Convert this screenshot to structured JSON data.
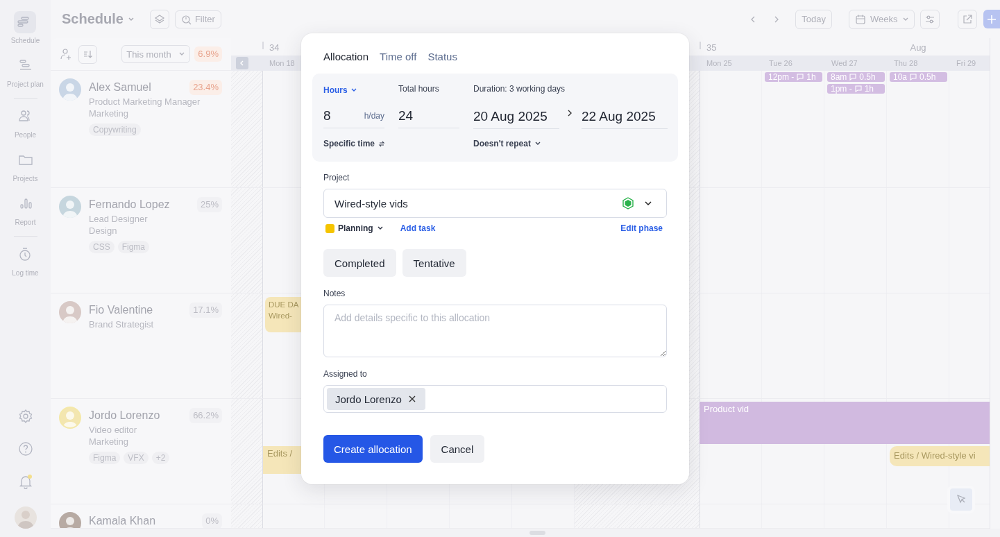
{
  "nav": {
    "items": [
      {
        "label": "Schedule",
        "selected": true
      },
      {
        "label": "Project plan",
        "selected": false
      },
      {
        "label": "People",
        "selected": false
      },
      {
        "label": "Projects",
        "selected": false
      },
      {
        "label": "Report",
        "selected": false
      },
      {
        "label": "Log time",
        "selected": false
      }
    ],
    "notifications_unread": true
  },
  "toolbar": {
    "title": "Schedule",
    "filter": "Filter",
    "today": "Today",
    "view": "Weeks"
  },
  "people_header": {
    "period": "This month",
    "utilization": "6.9%",
    "over": true
  },
  "calendar": {
    "weeks": [
      "34",
      "35"
    ],
    "month": "Aug",
    "days": [
      "Mon 18",
      "Mon 25",
      "Tue 26",
      "Wed 27",
      "Thu 28",
      "Fri 29"
    ]
  },
  "people": [
    {
      "name": "Alex Samuel",
      "role": "Product Marketing Manager",
      "department": "Marketing",
      "utilization": "23.4%",
      "over": true,
      "tags": [
        "Copywriting"
      ],
      "events": [
        {
          "kind": "chip",
          "time": "12pm -",
          "hours": "1h",
          "color": "#d3bde2"
        },
        {
          "kind": "chip",
          "time": "8am",
          "hours": "0.5h",
          "color": "#d3bde2"
        },
        {
          "kind": "chip",
          "time": "1pm -",
          "hours": "1h",
          "color": "#d3bde2"
        },
        {
          "kind": "chip",
          "time": "10a",
          "hours": "0.5h",
          "color": "#d3bde2"
        }
      ]
    },
    {
      "name": "Fernando Lopez",
      "role": "Lead Designer",
      "department": "Design",
      "utilization": "25%",
      "over": false,
      "tags": [
        "CSS",
        "Figma"
      ]
    },
    {
      "name": "Fio Valentine",
      "role": "Brand Strategist",
      "utilization": "17.1%",
      "over": false,
      "events": [
        {
          "kind": "block",
          "lines": [
            "DUE DA",
            "Wired-"
          ],
          "color": "#f5e6b9"
        }
      ]
    },
    {
      "name": "Jordo Lorenzo",
      "role": "Video editor",
      "department": "Marketing",
      "utilization": "66.2%",
      "over": false,
      "tags": [
        "Figma",
        "VFX",
        "+2"
      ],
      "events": [
        {
          "kind": "bar",
          "lines": [
            "Edits /"
          ],
          "color": "#f5e6b9"
        },
        {
          "kind": "bar",
          "lines": [
            "Product vid"
          ],
          "color": "#d1bae0"
        },
        {
          "kind": "bar",
          "lines": [
            "Edits / Wired-style vi"
          ],
          "color": "#f5e6b9"
        }
      ]
    },
    {
      "name": "Kamala Khan",
      "utilization": "0%",
      "over": false
    }
  ],
  "dialog": {
    "tabs": [
      {
        "label": "Allocation",
        "selected": true
      },
      {
        "label": "Time off",
        "selected": false
      },
      {
        "label": "Status",
        "selected": false
      }
    ],
    "unit": "Hours",
    "total_label": "Total hours",
    "duration": "Duration: 3 working days",
    "per_day": "8",
    "per_day_unit": "h/day",
    "total": "24",
    "start": "20 Aug 2025",
    "end": "22 Aug 2025",
    "specific_time": "Specific time",
    "repeat": "Doesn't repeat",
    "project_label": "Project",
    "project": "Wired-style vids",
    "phase": {
      "label": "Planning",
      "color": "#f5c400"
    },
    "add_task": "Add task",
    "edit_phase": "Edit phase",
    "toggles": [
      {
        "label": "Completed",
        "on": false
      },
      {
        "label": "Tentative",
        "on": false
      }
    ],
    "notes": {
      "label": "Notes",
      "placeholder": "Add details specific to this allocation"
    },
    "assigned_label": "Assigned to",
    "assignees": [
      "Jordo Lorenzo"
    ],
    "primary": "Create allocation",
    "secondary": "Cancel"
  }
}
